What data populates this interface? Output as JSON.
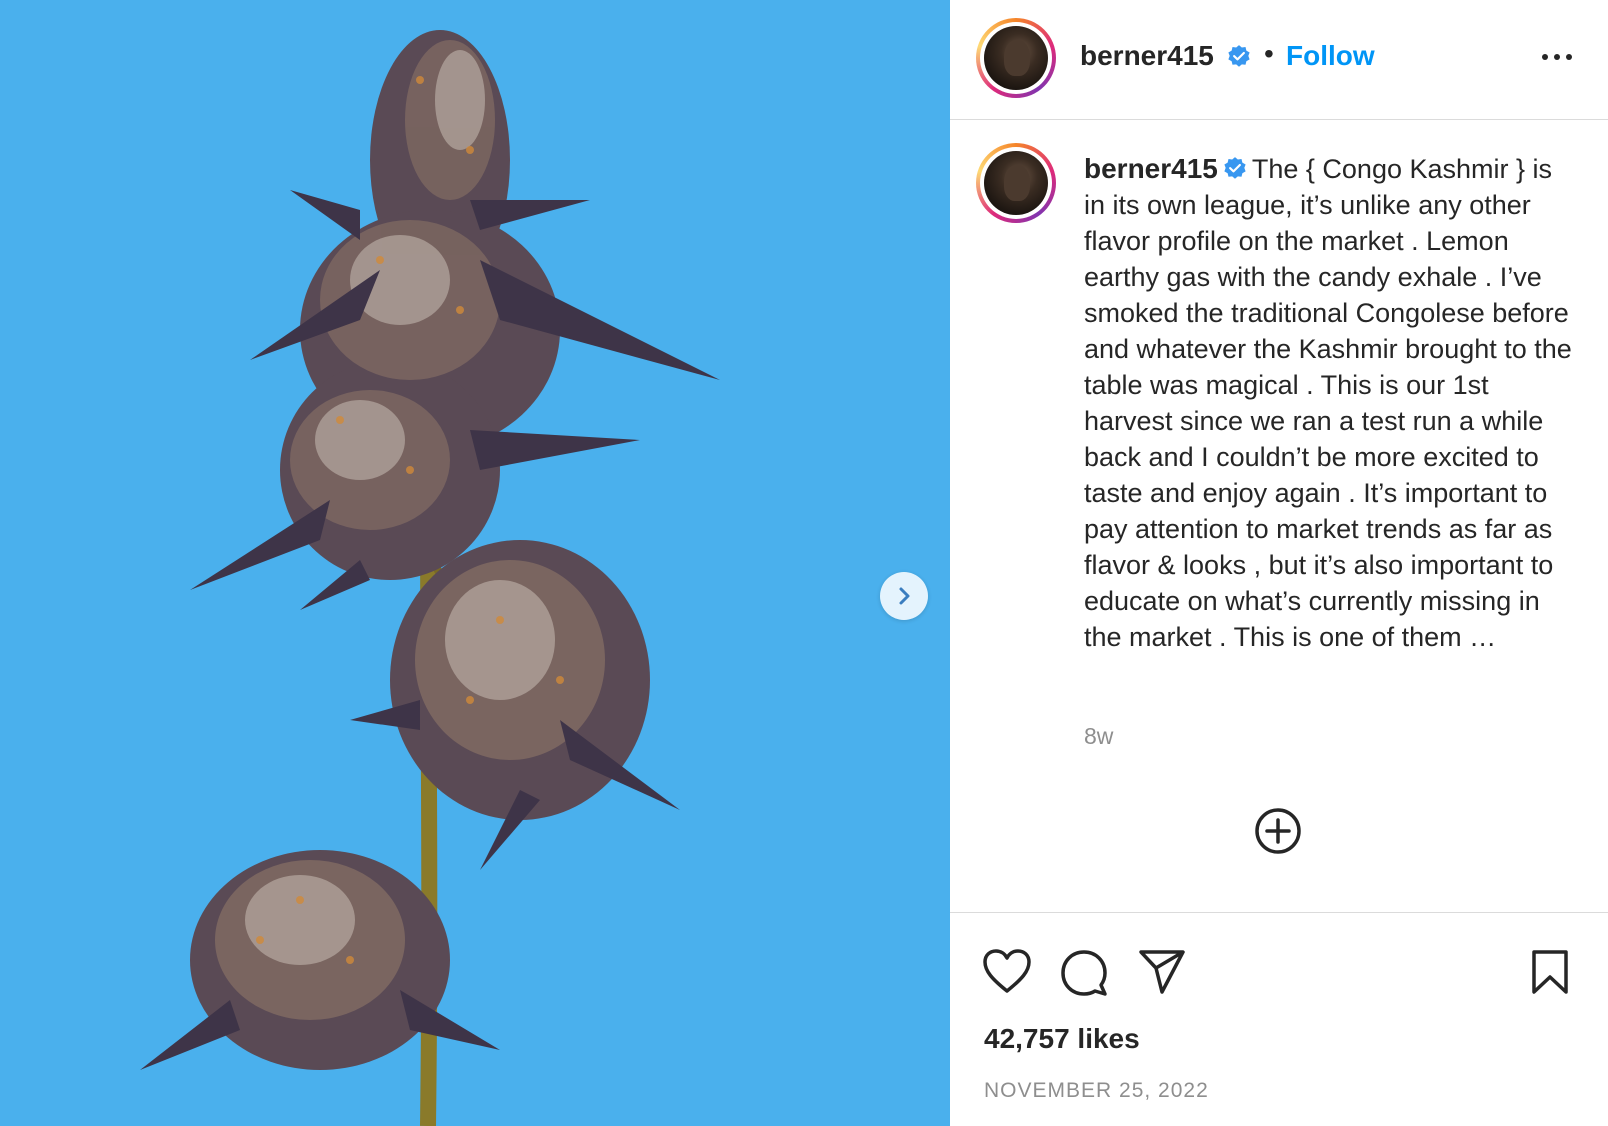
{
  "media": {
    "alt_icon": "cannabis-plant-photo",
    "background_color": "#4ab0ed",
    "next_icon": "chevron-right-icon"
  },
  "header": {
    "username": "berner415",
    "verified_icon": "verified-badge-icon",
    "separator": "•",
    "follow_label": "Follow",
    "more_icon": "more-options-icon"
  },
  "caption": {
    "username": "berner415",
    "text": "The { Congo Kashmir } is in its own league, it’s unlike any other flavor profile on the market . Lemon earthy gas with the candy exhale . I’ve smoked the traditional Congolese before and whatever the Kashmir brought to the table was magical . This is our 1st harvest since we ran a test run a while back and I couldn’t be more excited to taste and enjoy again . It’s important to pay attention to market trends as far as flavor & looks , but it’s also important to educate on what’s currently missing in the market . This is one of them …",
    "timestamp": "8w"
  },
  "add_comment_icon": "plus-circle-icon",
  "actions": {
    "like_icon": "heart-icon",
    "comment_icon": "comment-icon",
    "share_icon": "share-icon",
    "save_icon": "bookmark-icon",
    "likes_text": "42,757 likes",
    "date_text": "NOVEMBER 25, 2022"
  },
  "colors": {
    "accent": "#0095f6",
    "verified": "#3897f0",
    "text": "#262626",
    "muted": "#8e8e8e",
    "divider": "#dbdbdb"
  }
}
